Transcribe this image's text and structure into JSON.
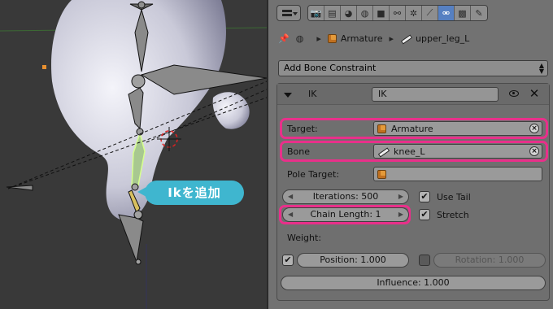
{
  "viewport": {
    "callout_text": "Ikを追加"
  },
  "properties": {
    "tab_icons": [
      "render-icon",
      "render-layers-icon",
      "scene-icon",
      "world-icon",
      "object-icon",
      "constraints-icon",
      "modifiers-icon",
      "bone-icon",
      "bone-constraints-icon",
      "material-icon",
      "texture-icon"
    ],
    "active_tab": "bone-constraints-icon",
    "breadcrumb": {
      "object": "Armature",
      "bone": "upper_leg_L"
    },
    "add_constraint_label": "Add Bone Constraint",
    "constraint": {
      "type": "IK",
      "name": "IK",
      "target_label": "Target:",
      "target_value": "Armature",
      "bone_label": "Bone",
      "bone_value": "knee_L",
      "pole_target_label": "Pole Target:",
      "pole_target_value": "",
      "iterations_label": "Iterations: 500",
      "chain_length_label": "Chain Length: 1",
      "use_tail_label": "Use Tail",
      "use_tail": true,
      "stretch_label": "Stretch",
      "stretch": true,
      "weight_label": "Weight:",
      "position_label": "Position: 1.000",
      "position_enabled": true,
      "rotation_label": "Rotation: 1.000",
      "rotation_enabled": false,
      "influence_label": "Influence: 1.000"
    },
    "highlight_color": "#e8308a",
    "active_tab_color": "#5680c2"
  }
}
